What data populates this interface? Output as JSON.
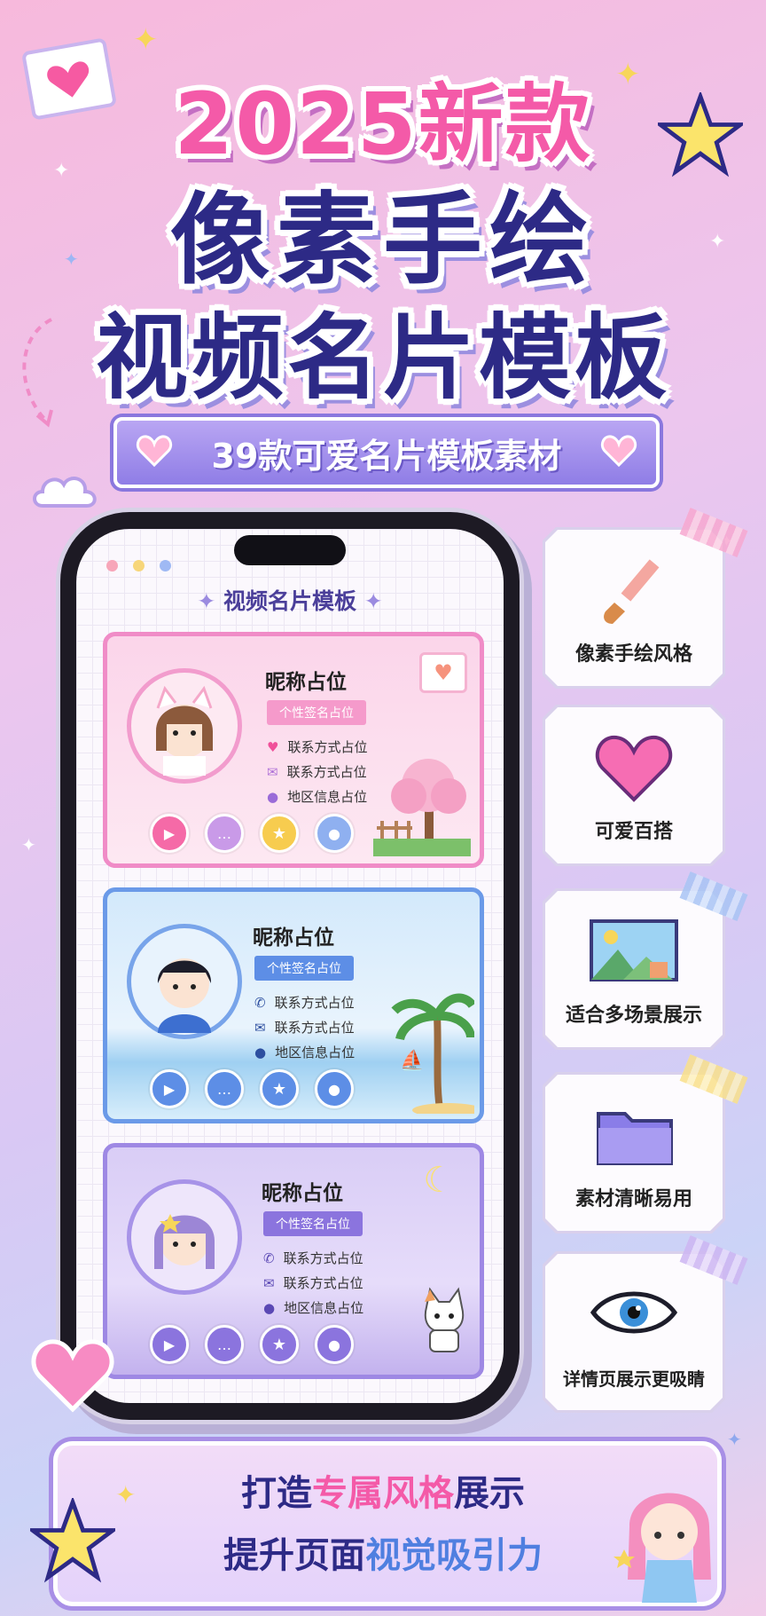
{
  "headline": {
    "line1": "2025新款",
    "line2": "像素手绘",
    "line3": "视频名片模板"
  },
  "banner": {
    "text": "39款可爱名片模板素材"
  },
  "phone": {
    "screen_title": "视频名片模板",
    "cards": [
      {
        "name": "昵称占位",
        "signature": "个性签名占位",
        "contact1": "联系方式占位",
        "contact2": "联系方式占位",
        "location": "地区信息占位",
        "theme": "pink"
      },
      {
        "name": "昵称占位",
        "signature": "个性签名占位",
        "contact1": "联系方式占位",
        "contact2": "联系方式占位",
        "location": "地区信息占位",
        "theme": "blue"
      },
      {
        "name": "昵称占位",
        "signature": "个性签名占位",
        "contact1": "联系方式占位",
        "contact2": "联系方式占位",
        "location": "地区信息占位",
        "theme": "purple"
      }
    ]
  },
  "features": [
    {
      "label": "像素手绘风格",
      "icon": "paintbrush-icon"
    },
    {
      "label": "可爱百搭",
      "icon": "heart-icon"
    },
    {
      "label": "适合多场景展示",
      "icon": "landscape-picture-icon"
    },
    {
      "label": "素材清晰易用",
      "icon": "folder-icon"
    },
    {
      "label": "详情页展示更吸睛",
      "icon": "eye-icon"
    }
  ],
  "footer": {
    "line1_pre": "打造",
    "line1_em": "专属风格",
    "line1_post": "展示",
    "line2_pre": "提升页面",
    "line2_em": "视觉吸引力"
  },
  "colors": {
    "pink": "#f45aa8",
    "navy": "#2d2a86",
    "purple": "#8f7de6",
    "blue": "#4f7fe0"
  }
}
